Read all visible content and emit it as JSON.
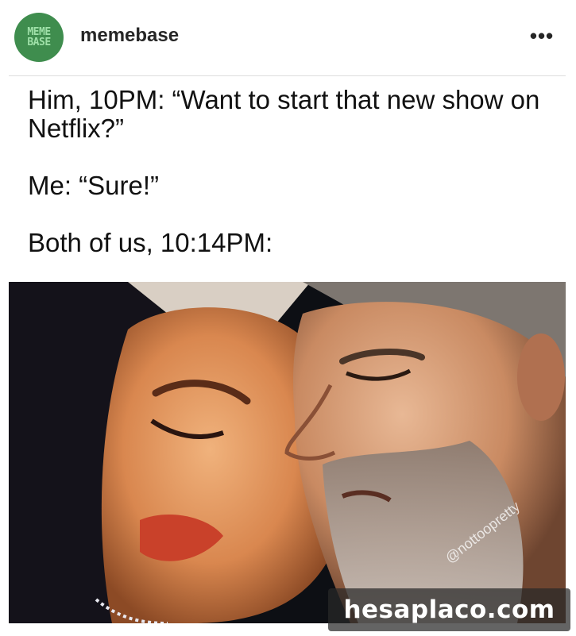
{
  "post": {
    "avatar_text_line1": "MEME",
    "avatar_text_line2": "BASE",
    "username": "memebase",
    "more_icon": "•••"
  },
  "meme": {
    "line1": "Him, 10PM: “Want to start that new show on Netflix?”",
    "line2": "Me: “Sure!”",
    "line3": "Both of us, 10:14PM:",
    "photo_credit": "@nottoopretty"
  },
  "watermark": "hesaplaco.com"
}
